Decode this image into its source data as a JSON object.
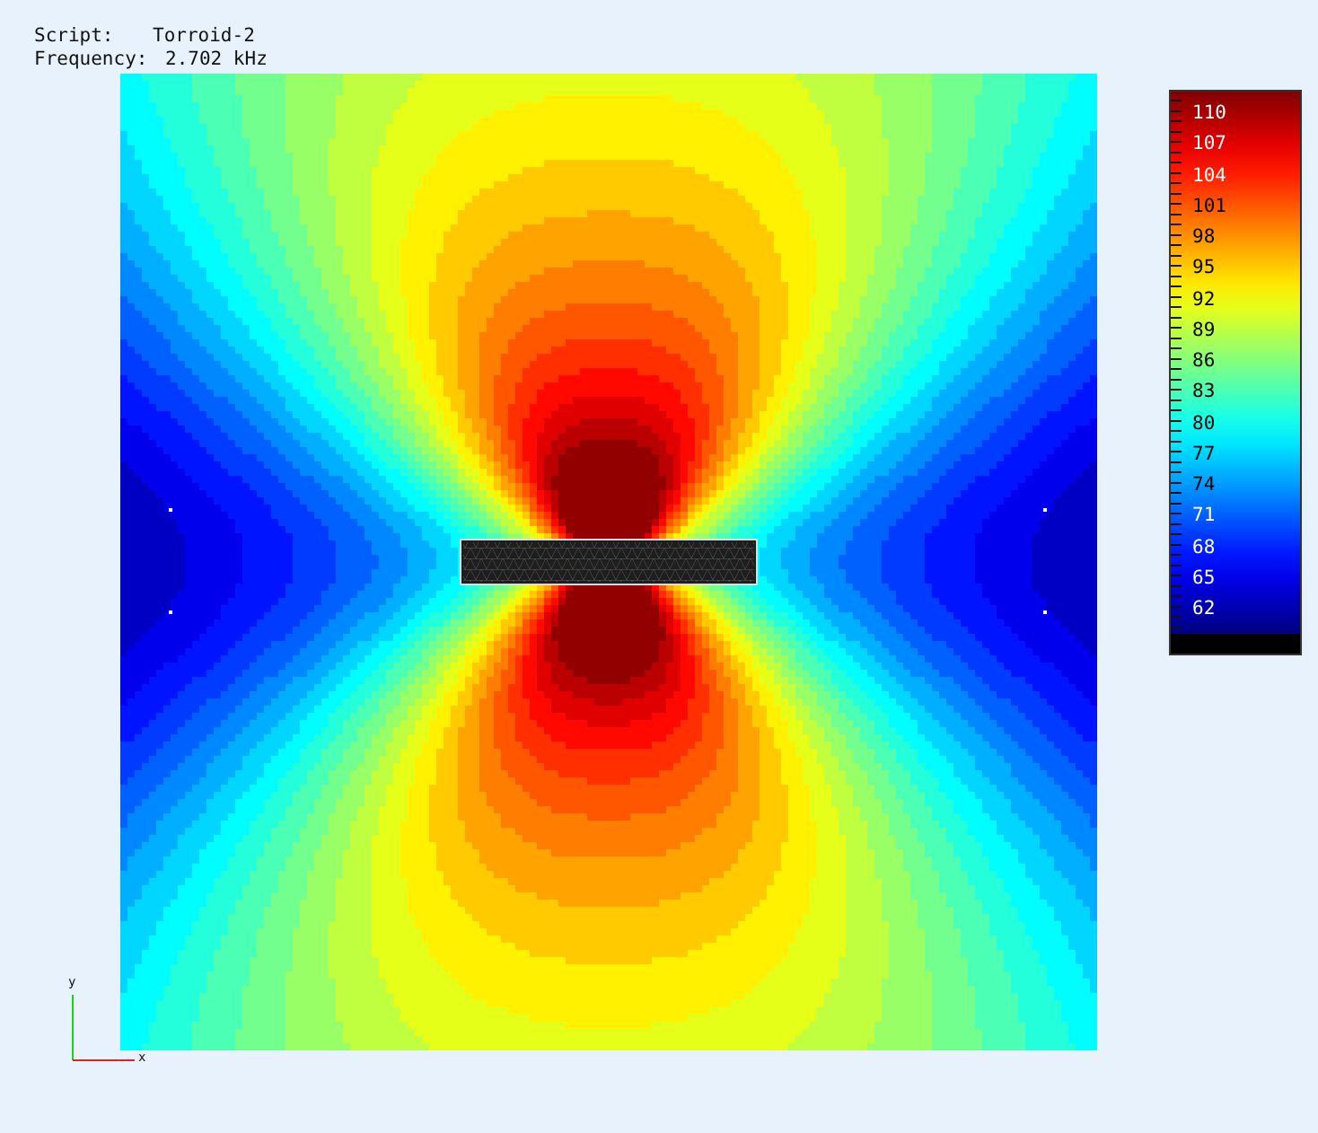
{
  "info": {
    "script_label": "Script:",
    "script_value": "Torroid-2",
    "frequency_label": "Frequency:",
    "frequency_value": "2.702 kHz"
  },
  "colorbar": {
    "ticks": [
      "110",
      "107",
      "104",
      "101",
      "98",
      "95",
      "92",
      "89",
      "86",
      "83",
      "80",
      "77",
      "74",
      "71",
      "68",
      "65",
      "62"
    ]
  },
  "axes": {
    "x_label": "x",
    "y_label": "y"
  }
}
